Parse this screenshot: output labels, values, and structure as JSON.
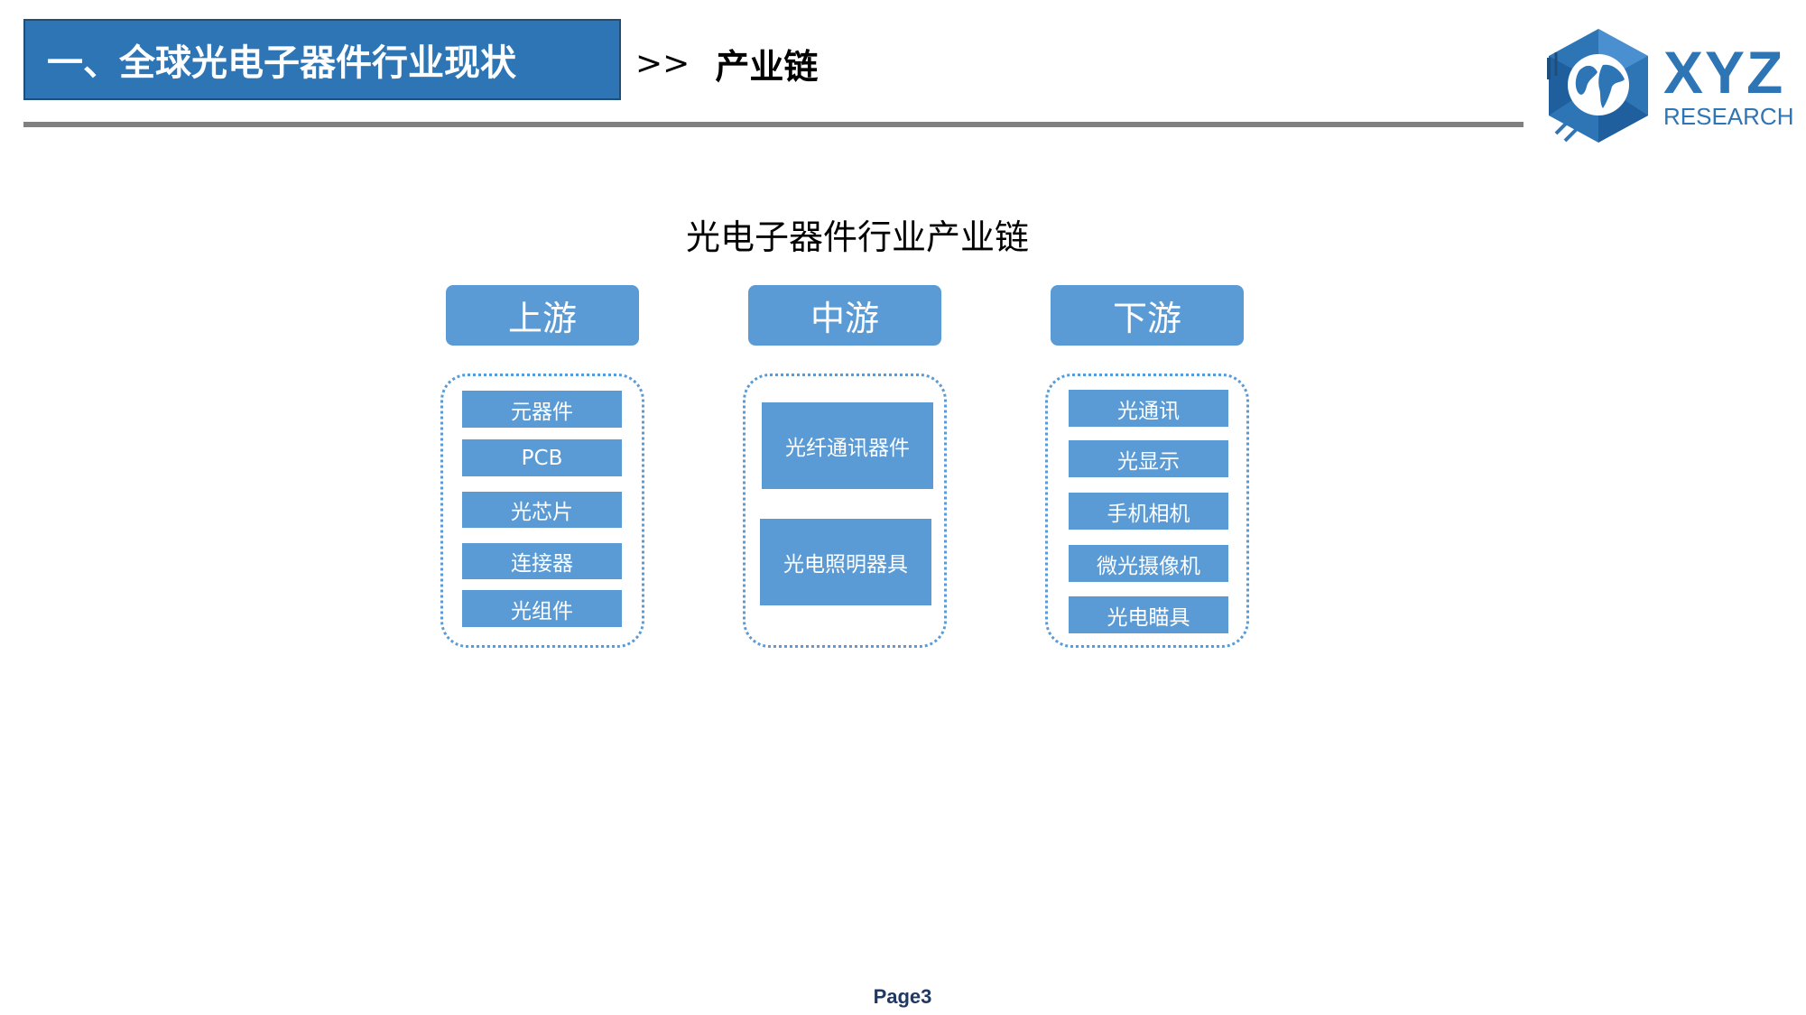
{
  "header": {
    "section_title": "一、全球光电子器件行业现状",
    "separator": ">>",
    "breadcrumb": "产业链"
  },
  "logo": {
    "main": "XYZ",
    "sub": "RESEARCH"
  },
  "diagram": {
    "title": "光电子器件行业产业链",
    "stages": [
      {
        "label": "上游",
        "items": [
          "元器件",
          "PCB",
          "光芯片",
          "连接器",
          "光组件"
        ]
      },
      {
        "label": "中游",
        "items": [
          "光纤通讯器件",
          "光电照明器具"
        ]
      },
      {
        "label": "下游",
        "items": [
          "光通讯",
          "光显示",
          "手机相机",
          "微光摄像机",
          "光电瞄具"
        ]
      }
    ]
  },
  "footer": {
    "page": "Page3"
  },
  "colors": {
    "title_bar": "#2E75B6",
    "stage_fill": "#5B9BD5",
    "rule": "#808080",
    "logo": "#2E75B6"
  }
}
